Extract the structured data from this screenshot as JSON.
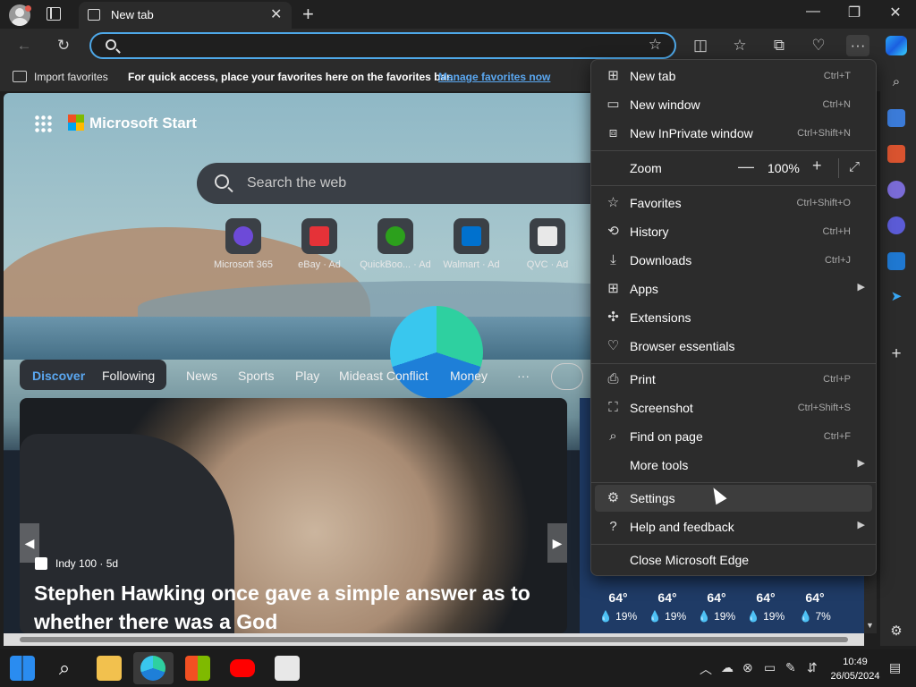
{
  "tab": {
    "title": "New tab"
  },
  "address": {
    "value": "",
    "placeholder": ""
  },
  "favorites_bar": {
    "import_label": "Import favorites",
    "hint": "For quick access, place your favorites here on the favorites bar.",
    "manage_link": "Manage favorites now"
  },
  "newtab": {
    "brand": "Microsoft Start",
    "search_placeholder": "Search the web",
    "tiles": [
      {
        "label": "Microsoft 365",
        "color": "#6d4ad8"
      },
      {
        "label": "eBay · Ad",
        "color": "#e53238"
      },
      {
        "label": "QuickBoo... · Ad",
        "color": "#2ca01c"
      },
      {
        "label": "Walmart · Ad",
        "color": "#0071ce"
      },
      {
        "label": "QVC · Ad",
        "color": "#e8e8e8"
      }
    ],
    "feed_tabs": [
      "Discover",
      "Following",
      "News",
      "Sports",
      "Play",
      "Mideast Conflict",
      "Money",
      "···"
    ],
    "hero": {
      "source": "Indy 100 · 5d",
      "title": "Stephen Hawking once gave a simple answer as to whether there was a God"
    },
    "weather": [
      {
        "temp": "64°",
        "rain": "19%"
      },
      {
        "temp": "64°",
        "rain": "19%"
      },
      {
        "temp": "64°",
        "rain": "19%"
      },
      {
        "temp": "64°",
        "rain": "19%"
      },
      {
        "temp": "64°",
        "rain": "7%"
      }
    ]
  },
  "menu": {
    "items": [
      {
        "label": "New tab",
        "shortcut": "Ctrl+T",
        "icon": "new-tab-icon"
      },
      {
        "label": "New window",
        "shortcut": "Ctrl+N",
        "icon": "window-icon"
      },
      {
        "label": "New InPrivate window",
        "shortcut": "Ctrl+Shift+N",
        "icon": "inprivate-icon"
      },
      {
        "label": "Zoom",
        "value": "100%",
        "icon": ""
      },
      {
        "label": "Favorites",
        "shortcut": "Ctrl+Shift+O",
        "icon": "star-list-icon"
      },
      {
        "label": "History",
        "shortcut": "Ctrl+H",
        "icon": "history-icon"
      },
      {
        "label": "Downloads",
        "shortcut": "Ctrl+J",
        "icon": "download-icon"
      },
      {
        "label": "Apps",
        "shortcut": "",
        "icon": "apps-icon",
        "submenu": true
      },
      {
        "label": "Extensions",
        "shortcut": "",
        "icon": "puzzle-icon"
      },
      {
        "label": "Browser essentials",
        "shortcut": "",
        "icon": "heart-pulse-icon"
      },
      {
        "label": "Print",
        "shortcut": "Ctrl+P",
        "icon": "print-icon"
      },
      {
        "label": "Screenshot",
        "shortcut": "Ctrl+Shift+S",
        "icon": "screenshot-icon"
      },
      {
        "label": "Find on page",
        "shortcut": "Ctrl+F",
        "icon": "find-icon"
      },
      {
        "label": "More tools",
        "shortcut": "",
        "icon": "",
        "submenu": true
      },
      {
        "label": "Settings",
        "shortcut": "",
        "icon": "gear-icon"
      },
      {
        "label": "Help and feedback",
        "shortcut": "",
        "icon": "help-icon",
        "submenu": true
      },
      {
        "label": "Close Microsoft Edge",
        "shortcut": "",
        "icon": ""
      }
    ]
  },
  "clock": {
    "time": "10:49",
    "date": "26/05/2024"
  }
}
